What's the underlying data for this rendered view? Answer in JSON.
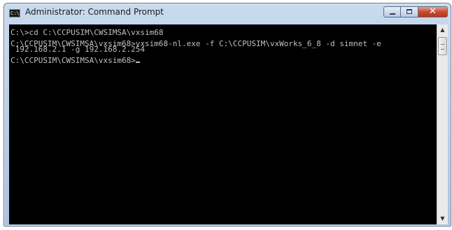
{
  "window": {
    "title": "Administrator: Command Prompt",
    "icon": "cmd-icon",
    "controls": {
      "minimize": "minimize-icon",
      "maximize": "maximize-icon",
      "close": "close-icon",
      "close_glyph": "✕"
    }
  },
  "console": {
    "lines": [
      "C:\\>cd C:\\CCPUSIM\\CWSIMSA\\vxsim68",
      "",
      "C:\\CCPUSIM\\CWSIMSA\\vxsim68>vxsim68-nl.exe -f C:\\CCPUSIM\\vxWorks_6_8 -d simnet -e",
      " 192.168.2.1 -g 192.168.2.254",
      "",
      "C:\\CCPUSIM\\CWSIMSA\\vxsim68>"
    ],
    "text_color": "#c0c0c0",
    "background": "#000000"
  },
  "scrollbar": {
    "up_arrow": "▲",
    "down_arrow": "▼"
  }
}
